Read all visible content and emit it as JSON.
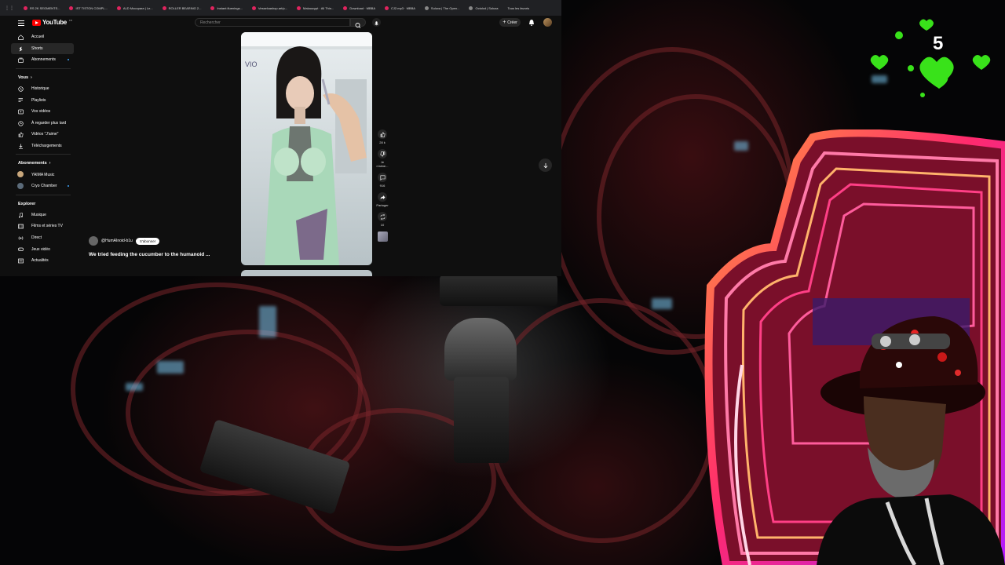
{
  "browser": {
    "tabs": [
      "",
      "RS 2K SEGMENTS...",
      "IST TISTON COMPL...",
      "ALD Mocopara | Le...",
      "ROLLER BEARING 2...",
      "Instant.fluenings...",
      "Vesselcashop.art/p...",
      "Makaucypt · All Thin...",
      "Download · MBBA",
      "CJ2.mp3 · MBBA",
      "Suluxa | The Open...",
      "Octolcd | Suluxa",
      "Tous les favoris"
    ]
  },
  "youtube": {
    "logo": "YouTube",
    "logo_cc": "FR",
    "search_placeholder": "Rechercher",
    "create_label": "Créer",
    "sidebar": {
      "main": [
        {
          "label": "Accueil",
          "icon": "home-icon"
        },
        {
          "label": "Shorts",
          "icon": "shorts-icon",
          "active": true
        },
        {
          "label": "Abonnements",
          "icon": "subscriptions-icon"
        }
      ],
      "you_header": "Vous",
      "you": [
        {
          "label": "Historique",
          "icon": "history-icon"
        },
        {
          "label": "Playlists",
          "icon": "playlist-icon"
        },
        {
          "label": "Vos vidéos",
          "icon": "video-icon"
        },
        {
          "label": "À regarder plus tard",
          "icon": "clock-icon"
        },
        {
          "label": "Vidéos \"J'aime\"",
          "icon": "like-icon"
        },
        {
          "label": "Téléchargements",
          "icon": "download-icon"
        }
      ],
      "subs_header": "Abonnements",
      "subs": [
        {
          "label": "YAIMA Music",
          "color": "#c9a77c"
        },
        {
          "label": "Cryo Chamber",
          "color": "#5b6b7a"
        }
      ],
      "explore_header": "Explorer",
      "explore": [
        {
          "label": "Musique",
          "icon": "music-icon"
        },
        {
          "label": "Films et séries TV",
          "icon": "film-icon"
        },
        {
          "label": "Direct",
          "icon": "live-icon"
        },
        {
          "label": "Jeux vidéo",
          "icon": "game-icon"
        },
        {
          "label": "Actualités",
          "icon": "news-icon"
        }
      ]
    },
    "short": {
      "channel": "@HumAInoid-b1u",
      "subscribe_label": "S'abonner",
      "title": "We tried feeding the cucumber to the humanoid ...",
      "actions": {
        "likes": "28 k",
        "dislike_label": "Je n'aime...",
        "comments": "916",
        "share_label": "Partager",
        "remix": "10"
      }
    }
  },
  "overlay": {
    "counter": "5"
  },
  "colors": {
    "yt_bg": "#0f0f0f",
    "yt_red": "#ff0000",
    "heart_green": "#39e21a",
    "neon_pink": "#ff2a6d"
  }
}
